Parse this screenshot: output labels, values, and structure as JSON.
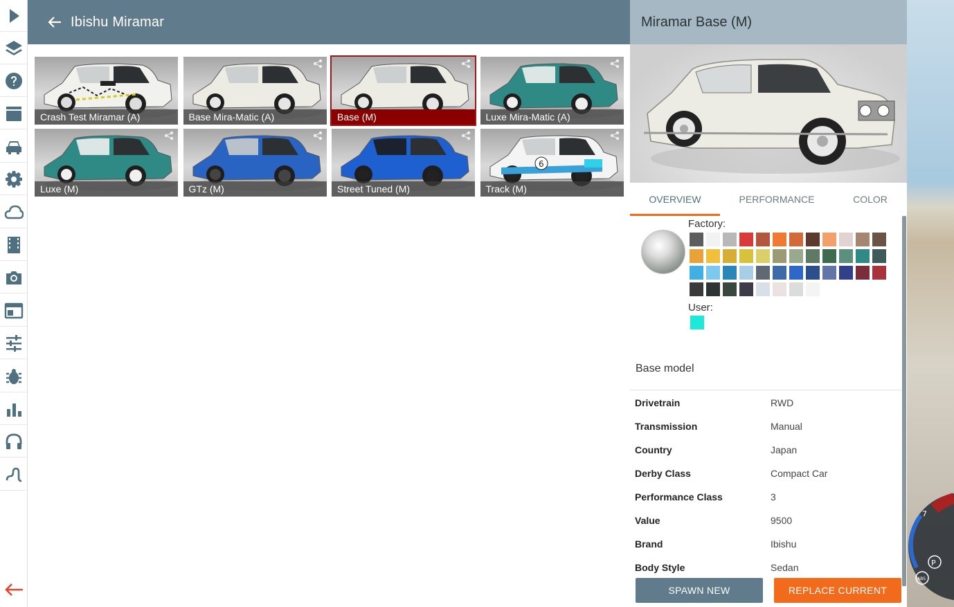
{
  "header": {
    "title": "Ibishu Miramar"
  },
  "sidebar": {
    "items": [
      {
        "icon": "play-icon"
      },
      {
        "icon": "layers-icon"
      },
      {
        "icon": "help-icon"
      },
      {
        "icon": "clapperboard-icon"
      },
      {
        "icon": "car-icon"
      },
      {
        "icon": "gear-icon"
      },
      {
        "icon": "cloud-icon"
      },
      {
        "icon": "film-icon"
      },
      {
        "icon": "camera-icon"
      },
      {
        "icon": "window-icon"
      },
      {
        "icon": "sliders-icon"
      },
      {
        "icon": "bug-icon"
      },
      {
        "icon": "bar-chart-icon"
      },
      {
        "icon": "headphones-icon"
      },
      {
        "icon": "route-icon"
      }
    ],
    "back_icon": "arrow-left-icon"
  },
  "configs": [
    {
      "label": "Crash Test Miramar (A)",
      "body": "#f1f1ee",
      "wheel": "#dddddd",
      "roof": "#f1f1ee",
      "selected": false,
      "variant": "crash"
    },
    {
      "label": "Base Mira-Matic (A)",
      "body": "#ecebe4",
      "wheel": "#e6e6e6",
      "roof": "#ecebe4",
      "selected": false,
      "variant": "plain"
    },
    {
      "label": "Base (M)",
      "body": "#ecebe4",
      "wheel": "#e6e6e6",
      "roof": "#ecebe4",
      "selected": true,
      "variant": "plain"
    },
    {
      "label": "Luxe Mira-Matic (A)",
      "body": "#2f8a86",
      "wheel": "#f0f0f0",
      "roof": "#f0f0ee",
      "selected": false,
      "variant": "plain"
    },
    {
      "label": "Luxe (M)",
      "body": "#2f8a86",
      "wheel": "#f0f0f0",
      "roof": "#f0f0ee",
      "selected": false,
      "variant": "plain"
    },
    {
      "label": "GTz (M)",
      "body": "#2a64c2",
      "wheel": "#444444",
      "roof": "#2a64c2",
      "selected": false,
      "variant": "plain"
    },
    {
      "label": "Street Tuned (M)",
      "body": "#1f60d0",
      "wheel": "#222222",
      "roof": "#1b1b1b",
      "selected": false,
      "variant": "plain"
    },
    {
      "label": "Track (M)",
      "body": "#f4f4f4",
      "wheel": "#222222",
      "roof": "#f4f4f4",
      "selected": false,
      "variant": "track"
    }
  ],
  "details": {
    "title": "Miramar Base (M)",
    "tabs": [
      "OVERVIEW",
      "PERFORMANCE",
      "COLOR"
    ],
    "active_tab": "OVERVIEW",
    "factory_label": "Factory:",
    "user_label": "User:",
    "factory_colors": [
      "#5d5d5d",
      "#f2f2f2",
      "#b8b8b8",
      "#d93a3a",
      "#b2573e",
      "#f07a34",
      "#d26a3a",
      "#5c3b2e",
      "#f3a16c",
      "#e3d2d2",
      "#a48673",
      "#6b5445",
      "#e8a23a",
      "#f0c03c",
      "#d7ad35",
      "#d8c23c",
      "#d9d06a",
      "#9a9b72",
      "#9aa88e",
      "#5e7a64",
      "#3c6b4e",
      "#5d8f7e",
      "#2f8a86",
      "#3f5a5a",
      "#3fb0e4",
      "#7cc8ee",
      "#2a86b8",
      "#a8cde6",
      "#606874",
      "#3e6aa8",
      "#2f67c8",
      "#2c4f8c",
      "#6274a8",
      "#32408a",
      "#7a2e3c",
      "#a8333c",
      "#3a3a3a",
      "#2e3334",
      "#3a473e",
      "#3d3b47",
      "#d9dfe8",
      "#ece2e2",
      "#dcdcdc",
      "#f4f4f4"
    ],
    "user_colors": [
      "#1de8da"
    ],
    "overview_heading": "Base model",
    "specs": [
      {
        "key": "Drivetrain",
        "value": "RWD"
      },
      {
        "key": "Transmission",
        "value": "Manual"
      },
      {
        "key": "Country",
        "value": "Japan"
      },
      {
        "key": "Derby Class",
        "value": "Compact Car"
      },
      {
        "key": "Performance Class",
        "value": "3"
      },
      {
        "key": "Value",
        "value": "9500"
      },
      {
        "key": "Brand",
        "value": "Ibishu"
      },
      {
        "key": "Body Style",
        "value": "Sedan"
      }
    ],
    "spawn_label": "SPAWN NEW",
    "replace_label": "REPLACE CURRENT"
  },
  "hud": {
    "gear": "7",
    "park": "P",
    "abs": "ABS"
  },
  "colors": {
    "accent": "#f26a1b",
    "header": "#607b8c",
    "panel_header": "#a5b8c3",
    "selected": "#8a0000",
    "icon": "#4f7080"
  }
}
